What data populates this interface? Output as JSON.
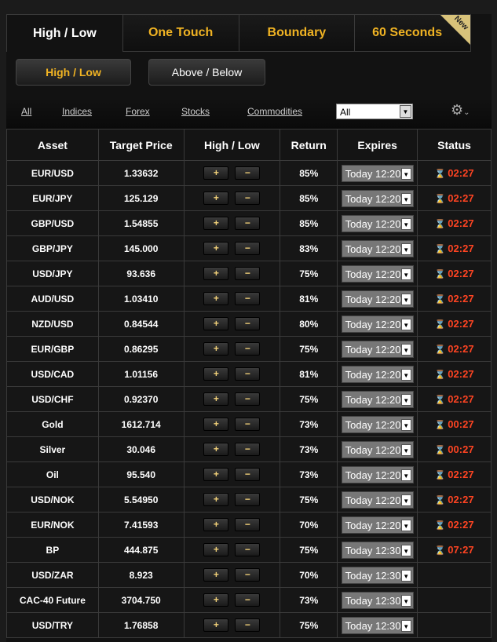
{
  "tabs": [
    {
      "label": "High / Low"
    },
    {
      "label": "One Touch"
    },
    {
      "label": "Boundary"
    },
    {
      "label": "60 Seconds",
      "badge": "New"
    }
  ],
  "subtabs": {
    "high_low": "High / Low",
    "above_below": "Above / Below"
  },
  "filters": {
    "links": [
      "All",
      "Indices",
      "Forex",
      "Stocks",
      "Commodities"
    ],
    "select_value": "All"
  },
  "headers": [
    "Asset",
    "Target Price",
    "High / Low",
    "Return",
    "Expires",
    "Status"
  ],
  "buttons": {
    "high": "+",
    "low": "−"
  },
  "rows": [
    [
      "EUR/USD",
      "1.33632",
      "85%",
      "Today 12:20",
      "02:27"
    ],
    [
      "EUR/JPY",
      "125.129",
      "85%",
      "Today 12:20",
      "02:27"
    ],
    [
      "GBP/USD",
      "1.54855",
      "85%",
      "Today 12:20",
      "02:27"
    ],
    [
      "GBP/JPY",
      "145.000",
      "83%",
      "Today 12:20",
      "02:27"
    ],
    [
      "USD/JPY",
      "93.636",
      "75%",
      "Today 12:20",
      "02:27"
    ],
    [
      "AUD/USD",
      "1.03410",
      "81%",
      "Today 12:20",
      "02:27"
    ],
    [
      "NZD/USD",
      "0.84544",
      "80%",
      "Today 12:20",
      "02:27"
    ],
    [
      "EUR/GBP",
      "0.86295",
      "75%",
      "Today 12:20",
      "02:27"
    ],
    [
      "USD/CAD",
      "1.01156",
      "81%",
      "Today 12:20",
      "02:27"
    ],
    [
      "USD/CHF",
      "0.92370",
      "75%",
      "Today 12:20",
      "02:27"
    ],
    [
      "Gold",
      "1612.714",
      "73%",
      "Today 12:20",
      "00:27"
    ],
    [
      "Silver",
      "30.046",
      "73%",
      "Today 12:20",
      "00:27"
    ],
    [
      "Oil",
      "95.540",
      "73%",
      "Today 12:20",
      "02:27"
    ],
    [
      "USD/NOK",
      "5.54950",
      "75%",
      "Today 12:20",
      "02:27"
    ],
    [
      "EUR/NOK",
      "7.41593",
      "70%",
      "Today 12:20",
      "02:27"
    ],
    [
      "BP",
      "444.875",
      "75%",
      "Today 12:30",
      "07:27"
    ],
    [
      "USD/ZAR",
      "8.923",
      "70%",
      "Today 12:30",
      ""
    ],
    [
      "CAC-40 Future",
      "3704.750",
      "73%",
      "Today 12:30",
      ""
    ],
    [
      "USD/TRY",
      "1.76858",
      "75%",
      "Today 12:30",
      ""
    ]
  ],
  "colors": {
    "accent": "#f0b323",
    "status": "#ff2a1a"
  }
}
